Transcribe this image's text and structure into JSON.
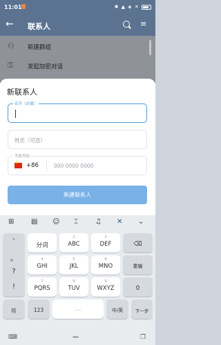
{
  "status": {
    "time": "11:01",
    "icons": "✱ ▲ ◈ ✕",
    "battery": ""
  },
  "appbar": {
    "title": "联系人",
    "back": "←",
    "sort": "≡"
  },
  "behind_list": [
    {
      "icon": "⚇",
      "label": "新建群组"
    },
    {
      "icon": "⚿",
      "label": "发起加密对话"
    }
  ],
  "dialog": {
    "title": "新联系人",
    "first_name_label": "名字（必填）",
    "last_name_placeholder": "姓氏（可选）",
    "phone_label": "手机号码",
    "country_code": "+86",
    "phone_placeholder": "000 0000 0000",
    "create_button": "新建联系人"
  },
  "keyboard": {
    "toolbar": [
      "⊞",
      "▤",
      "☺",
      "⌶",
      "♫",
      "✕",
      "⌄"
    ],
    "left_column": [
      "'",
      "。",
      "?",
      "!"
    ],
    "rows": [
      [
        {
          "main": "分词",
          "sub": ""
        },
        {
          "main": "ABC",
          "sub": "2"
        },
        {
          "main": "DEF",
          "sub": "3"
        },
        {
          "main": "⌫",
          "sub": ""
        }
      ],
      [
        {
          "main": "GHI",
          "sub": "4"
        },
        {
          "main": "JKL",
          "sub": "5"
        },
        {
          "main": "MNO",
          "sub": "6"
        },
        {
          "main": "重输",
          "sub": ""
        }
      ],
      [
        {
          "main": "PQRS",
          "sub": "7"
        },
        {
          "main": "TUV",
          "sub": "8"
        },
        {
          "main": "WXYZ",
          "sub": "9"
        },
        {
          "main": "0",
          "sub": ""
        }
      ]
    ],
    "bottom": {
      "symbols": "符",
      "numbers": "123",
      "space": "⋯",
      "lang": "中/英",
      "next": "下一步"
    }
  },
  "navbar": {
    "keyboard": "⌨",
    "home": "—",
    "clipboard": "❐"
  }
}
